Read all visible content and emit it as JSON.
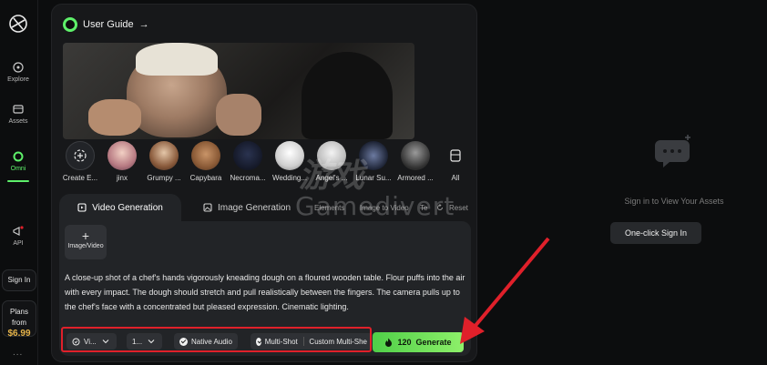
{
  "sidebar": {
    "items": [
      {
        "label": "Explore",
        "icon": "compass-icon"
      },
      {
        "label": "Assets",
        "icon": "folder-icon"
      },
      {
        "label": "Omni",
        "icon": "omni-ring-icon",
        "active": true
      }
    ],
    "api_label": "API",
    "sign_in_label": "Sign In",
    "plans_label": "Plans from",
    "plans_price": "$6.99",
    "more_label": "..."
  },
  "main": {
    "guide_label": "User Guide",
    "guide_arrow": "→",
    "styles": [
      {
        "label": "Create E...",
        "icon": "create-plus-icon"
      },
      {
        "label": "jinx"
      },
      {
        "label": "Grumpy ..."
      },
      {
        "label": "Capybara"
      },
      {
        "label": "Necroma..."
      },
      {
        "label": "Wedding..."
      },
      {
        "label": "Angel's ..."
      },
      {
        "label": "Lunar Su..."
      },
      {
        "label": "Armored ..."
      },
      {
        "label": "All",
        "icon": "layers-icon"
      }
    ],
    "tabs": [
      {
        "label": "Video Generation",
        "active": true
      },
      {
        "label": "Image Generation"
      },
      {
        "label": "Elements"
      },
      {
        "label": "Image to Video"
      },
      {
        "label": "Te"
      },
      {
        "label": "Reset"
      }
    ],
    "upload_label": "Image/Video",
    "prompt": "A close-up shot of a chef's hands vigorously kneading dough on a floured wooden table. Flour puffs into the air with every impact. The dough should stretch and pull realistically between the fingers. The camera pulls up to the chef's face with a concentrated but pleased expression. Cinematic lighting.",
    "controls": {
      "model": "Vi...",
      "duration": "1...",
      "native_audio": "Native Audio",
      "multi_shot": "Multi-Shot",
      "custom_multi": "Custom Multi-She"
    },
    "generate": {
      "cost": "120",
      "label": "Generate"
    }
  },
  "assets": {
    "empty_text": "Sign in to View Your Assets",
    "sign_in_button": "One-click Sign In"
  },
  "watermark": {
    "cjk": "游戏",
    "text": "Gamedivert"
  },
  "colors": {
    "accent_green": "#5ef06a",
    "highlight_red": "#e0202a",
    "price_gold": "#e7b54a"
  }
}
